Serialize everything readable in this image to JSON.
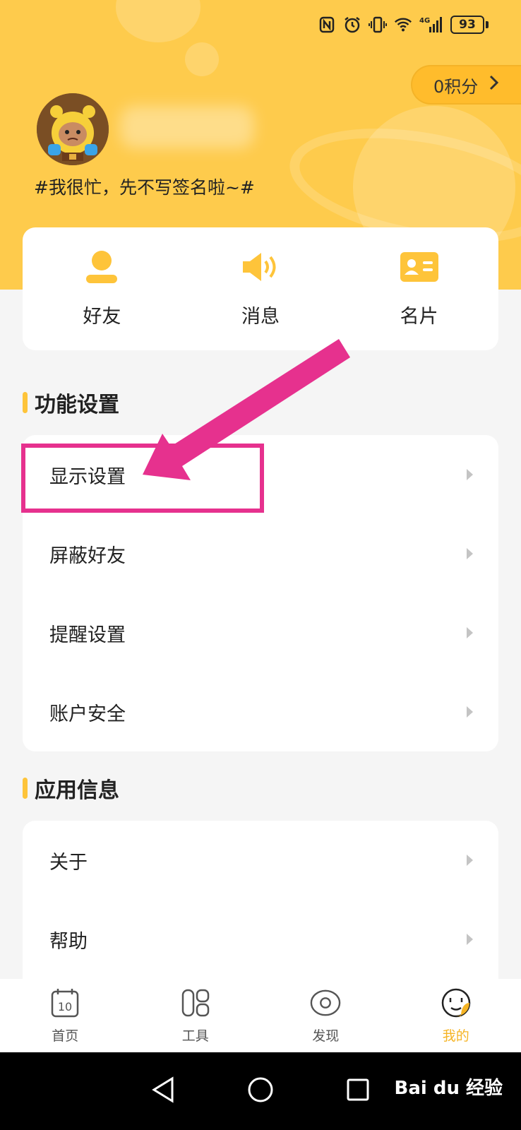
{
  "status_bar": {
    "battery": "93",
    "network": "4G"
  },
  "header": {
    "points_label": "0积分",
    "signature": "#我很忙，先不写签名啦~#"
  },
  "quick_actions": [
    {
      "label": "好友",
      "icon": "person-icon"
    },
    {
      "label": "消息",
      "icon": "speaker-icon"
    },
    {
      "label": "名片",
      "icon": "card-icon"
    }
  ],
  "sections": {
    "features": {
      "title": "功能设置",
      "items": [
        {
          "label": "显示设置"
        },
        {
          "label": "屏蔽好友"
        },
        {
          "label": "提醒设置"
        },
        {
          "label": "账户安全"
        }
      ]
    },
    "app_info": {
      "title": "应用信息",
      "items": [
        {
          "label": "关于"
        },
        {
          "label": "帮助"
        }
      ]
    }
  },
  "tabbar": [
    {
      "label": "首页",
      "icon": "calendar-icon",
      "icon_text": "10",
      "active": false
    },
    {
      "label": "工具",
      "icon": "tools-icon",
      "active": false
    },
    {
      "label": "发现",
      "icon": "eye-icon",
      "active": false
    },
    {
      "label": "我的",
      "icon": "face-icon",
      "active": true
    }
  ],
  "watermark": "Bai du 经验",
  "colors": {
    "accent_yellow": "#fecb4c",
    "highlight_pink": "#e6318e",
    "tab_active": "#f5b425"
  }
}
